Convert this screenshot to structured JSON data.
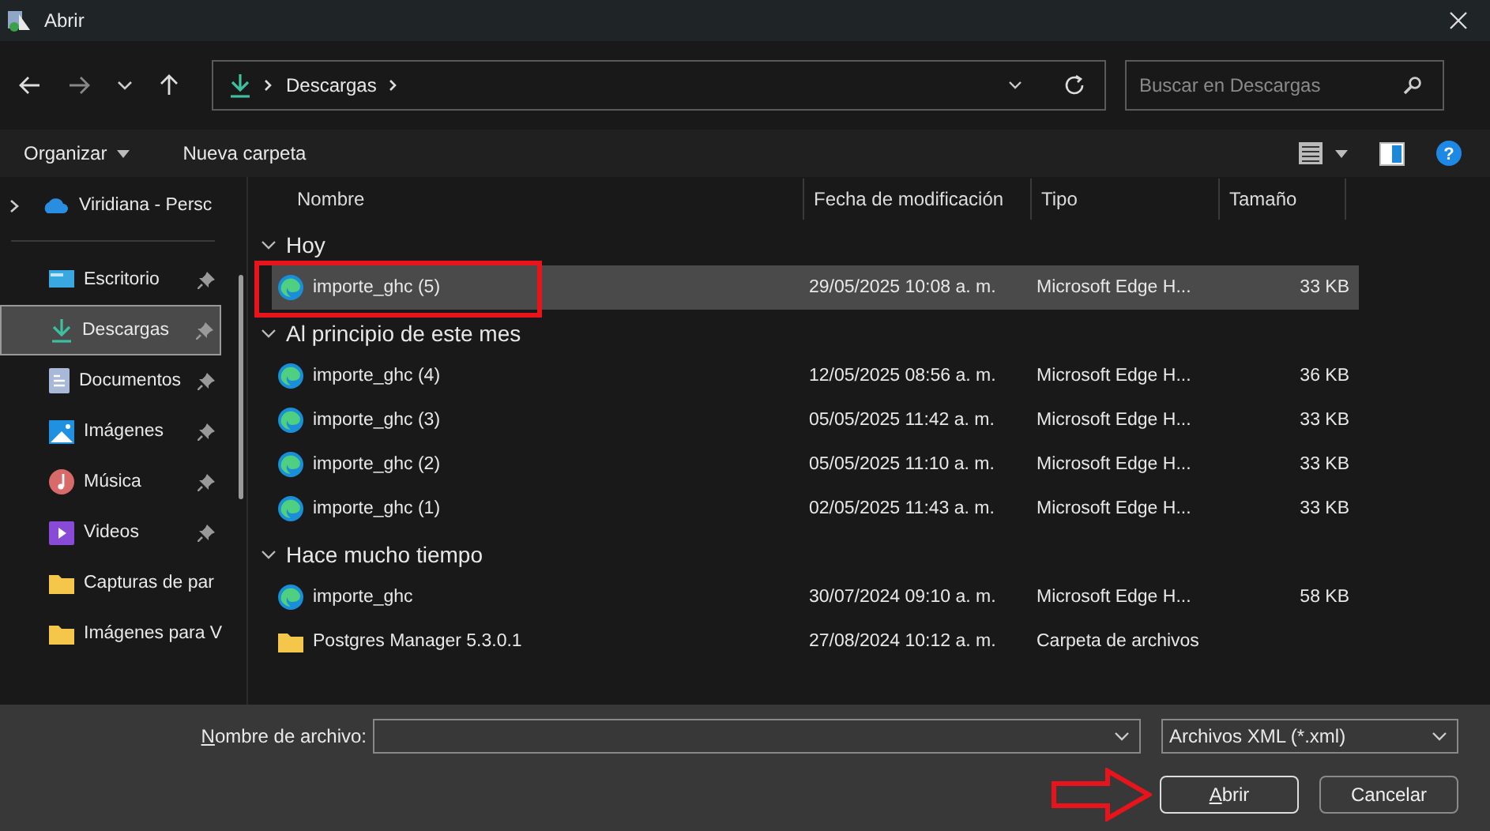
{
  "window": {
    "title": "Abrir"
  },
  "address": {
    "path": "Descargas"
  },
  "search": {
    "placeholder": "Buscar en Descargas"
  },
  "help": {
    "label": "?"
  },
  "toolbar": [
    {
      "label": "Organizar",
      "menu": true
    },
    {
      "label": "Nueva carpeta",
      "menu": false
    }
  ],
  "sidebar": {
    "items": [
      {
        "label": "Viridiana - Persc",
        "kind": "cloud",
        "pinned": false,
        "selected": false,
        "expandable": true
      },
      {
        "label": "Escritorio",
        "kind": "desktop",
        "pinned": true,
        "selected": false,
        "expandable": false
      },
      {
        "label": "Descargas",
        "kind": "download",
        "pinned": true,
        "selected": true,
        "expandable": false
      },
      {
        "label": "Documentos",
        "kind": "document",
        "pinned": true,
        "selected": false,
        "expandable": false
      },
      {
        "label": "Imágenes",
        "kind": "image",
        "pinned": true,
        "selected": false,
        "expandable": false
      },
      {
        "label": "Música",
        "kind": "music",
        "pinned": true,
        "selected": false,
        "expandable": false
      },
      {
        "label": "Videos",
        "kind": "video",
        "pinned": true,
        "selected": false,
        "expandable": false
      },
      {
        "label": "Capturas de par",
        "kind": "folder",
        "pinned": false,
        "selected": false,
        "expandable": false
      },
      {
        "label": "Imágenes para V",
        "kind": "folder",
        "pinned": false,
        "selected": false,
        "expandable": false
      }
    ]
  },
  "table": {
    "columns": [
      "Nombre",
      "Fecha de modificación",
      "Tipo",
      "Tamaño"
    ],
    "groups": [
      {
        "label": "Hoy",
        "expanded": true,
        "rows": [
          {
            "name": "importe_ghc (5)",
            "date": "29/05/2025 10:08 a. m.",
            "type": "Microsoft Edge H...",
            "size": "33 KB",
            "kind": "edge",
            "selected": true,
            "highlighted": true
          }
        ]
      },
      {
        "label": "Al principio de este mes",
        "expanded": true,
        "rows": [
          {
            "name": "importe_ghc (4)",
            "date": "12/05/2025 08:56 a. m.",
            "type": "Microsoft Edge H...",
            "size": "36 KB",
            "kind": "edge",
            "selected": false,
            "highlighted": false
          },
          {
            "name": "importe_ghc (3)",
            "date": "05/05/2025 11:42 a. m.",
            "type": "Microsoft Edge H...",
            "size": "33 KB",
            "kind": "edge",
            "selected": false,
            "highlighted": false
          },
          {
            "name": "importe_ghc (2)",
            "date": "05/05/2025 11:10 a. m.",
            "type": "Microsoft Edge H...",
            "size": "33 KB",
            "kind": "edge",
            "selected": false,
            "highlighted": false
          },
          {
            "name": "importe_ghc (1)",
            "date": "02/05/2025 11:43 a. m.",
            "type": "Microsoft Edge H...",
            "size": "33 KB",
            "kind": "edge",
            "selected": false,
            "highlighted": false
          }
        ]
      },
      {
        "label": "Hace mucho tiempo",
        "expanded": true,
        "rows": [
          {
            "name": "importe_ghc",
            "date": "30/07/2024 09:10 a. m.",
            "type": "Microsoft Edge H...",
            "size": "58 KB",
            "kind": "edge",
            "selected": false,
            "highlighted": false
          },
          {
            "name": "Postgres Manager 5.3.0.1",
            "date": "27/08/2024 10:12 a. m.",
            "type": "Carpeta de archivos",
            "kind": "folder",
            "selected": false,
            "highlighted": false
          }
        ]
      }
    ]
  },
  "footer": {
    "filename_label": "Nombre de archivo:",
    "filetype": "Archivos XML (*.xml)",
    "buttons": [
      {
        "label": "Abrir",
        "default": true,
        "pointed": true
      },
      {
        "label": "Cancelar",
        "default": false,
        "pointed": false
      }
    ]
  }
}
